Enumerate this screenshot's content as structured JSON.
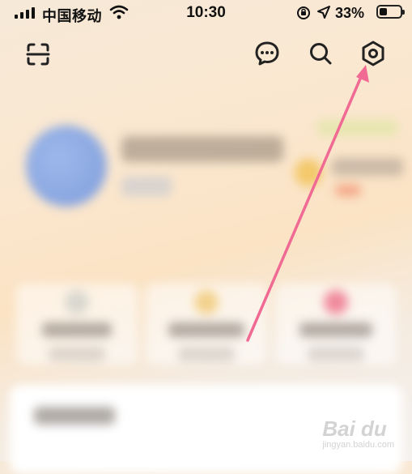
{
  "status_bar": {
    "carrier": "中国移动",
    "time": "10:30",
    "battery_percent": "33%",
    "battery_level": 0.33
  },
  "top_bar": {
    "icons": [
      "scan-icon",
      "message-icon",
      "search-icon",
      "settings-icon"
    ]
  },
  "annotation": {
    "arrow_color": "#f06a94",
    "points_to": "settings-icon"
  },
  "watermark": {
    "text": "Bai du",
    "sub": "jingyan.baidu.com"
  },
  "colors": {
    "accent": "#f06a94",
    "bg_warm": "#fbe3c4"
  }
}
